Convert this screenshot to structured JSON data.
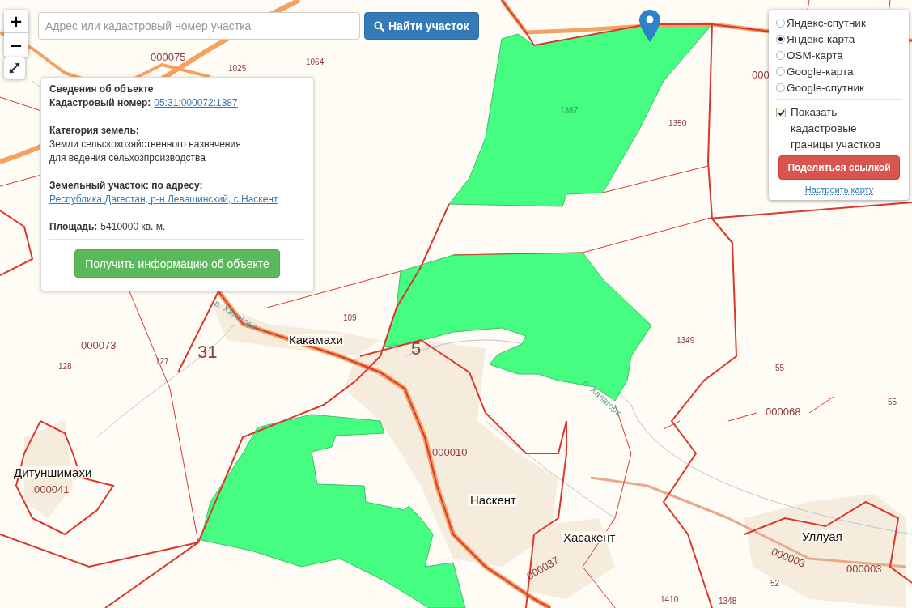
{
  "zoom_controls": {
    "zoom_in": "+",
    "zoom_out": "−"
  },
  "search": {
    "placeholder": "Адрес или кадастровый номер участка",
    "button": "Найти участок"
  },
  "info_popup": {
    "title": "Сведения об объекте",
    "cadastral_label": "Кадастровый номер:",
    "cadastral_number": "05:31:000072:1387",
    "category_label": "Категория земель:",
    "category_lines": [
      "Земли сельскохозяйственного назначения",
      "для ведения сельхозпроизводства"
    ],
    "address_label": "Земельный участок: по адресу:",
    "address": "Республика Дагестан, р-н Левашинский, с Наскент",
    "area_label": "Площадь:",
    "area_value": "5410000 кв. м.",
    "button": "Получить информацию об объекте"
  },
  "layers": {
    "options": [
      {
        "label": "Яндекс-спутник",
        "selected": false
      },
      {
        "label": "Яндекс-карта",
        "selected": true
      },
      {
        "label": "OSM-карта",
        "selected": false
      },
      {
        "label": "Google-карта",
        "selected": false
      },
      {
        "label": "Google-спутник",
        "selected": false
      }
    ],
    "show_borders": {
      "label": "Показать кадастровые границы участков",
      "checked": true
    },
    "share_button": "Поделиться ссылкой",
    "settings_link": "Настроить карту"
  },
  "map": {
    "labels": [
      {
        "text": "000075",
        "kind": "quarter"
      },
      {
        "text": "1025",
        "kind": "parcel"
      },
      {
        "text": "1064",
        "kind": "parcel"
      },
      {
        "text": "000",
        "kind": "quarter"
      },
      {
        "text": "1387",
        "kind": "selected_parcel"
      },
      {
        "text": "1350",
        "kind": "parcel"
      },
      {
        "text": "р. Халагорк",
        "kind": "river"
      },
      {
        "text": "109",
        "kind": "parcel"
      },
      {
        "text": "000073",
        "kind": "quarter"
      },
      {
        "text": "31",
        "kind": "district"
      },
      {
        "text": "Какамахи",
        "kind": "place"
      },
      {
        "text": "5",
        "kind": "district"
      },
      {
        "text": "1349",
        "kind": "parcel"
      },
      {
        "text": "128",
        "kind": "parcel"
      },
      {
        "text": "127",
        "kind": "parcel"
      },
      {
        "text": "55",
        "kind": "parcel"
      },
      {
        "text": "р. Халагорк",
        "kind": "river"
      },
      {
        "text": "55",
        "kind": "parcel"
      },
      {
        "text": "000068",
        "kind": "quarter"
      },
      {
        "text": "000010",
        "kind": "quarter"
      },
      {
        "text": "Дитуншимахи",
        "kind": "place"
      },
      {
        "text": "000041",
        "kind": "quarter"
      },
      {
        "text": "Наскент",
        "kind": "place"
      },
      {
        "text": "Хасакент",
        "kind": "place"
      },
      {
        "text": "Уллуая",
        "kind": "place"
      },
      {
        "text": "000003",
        "kind": "quarter"
      },
      {
        "text": "000037",
        "kind": "quarter"
      },
      {
        "text": "000003",
        "kind": "quarter"
      },
      {
        "text": "52",
        "kind": "parcel"
      },
      {
        "text": "1410",
        "kind": "parcel"
      },
      {
        "text": "1348",
        "kind": "parcel"
      }
    ]
  }
}
